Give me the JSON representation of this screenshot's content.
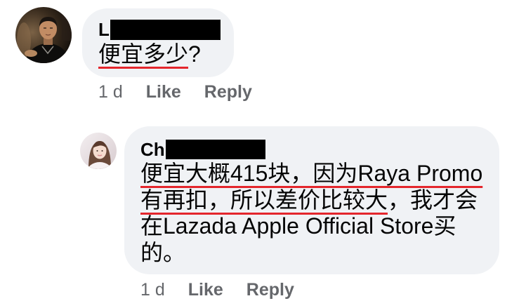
{
  "colors": {
    "page_background": "#ffffff",
    "bubble": "#f0f2f5",
    "text": "#050505",
    "meta": "#65676b",
    "annotation": "#e4262c",
    "redaction": "#000000"
  },
  "comment": {
    "author": "L",
    "lines": [
      {
        "segments": [
          {
            "text": "便宜多少",
            "underlined": true
          },
          {
            "text": "?",
            "underlined": false
          }
        ]
      }
    ],
    "time": "1 d",
    "like_label": "Like",
    "reply_label": "Reply",
    "replies": [
      {
        "author": "Ch",
        "lines": [
          {
            "segments": [
              {
                "text": "便宜大概415块，因为Raya Promo",
                "underlined": true
              }
            ]
          },
          {
            "segments": [
              {
                "text": "有再扣，所以差价比较大",
                "underlined": true
              },
              {
                "text": "，我才会",
                "underlined": false
              }
            ]
          },
          {
            "segments": [
              {
                "text": "在Lazada Apple Official Store买",
                "underlined": false
              }
            ]
          },
          {
            "segments": [
              {
                "text": "的。",
                "underlined": false
              }
            ]
          }
        ],
        "time": "1 d",
        "like_label": "Like",
        "reply_label": "Reply"
      }
    ]
  }
}
